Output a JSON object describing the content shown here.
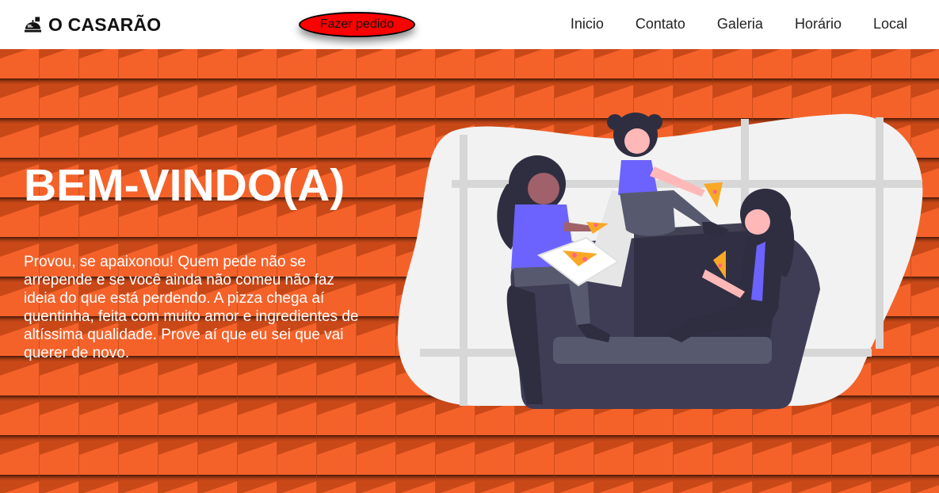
{
  "header": {
    "brand": {
      "icon": "food-tray-icon",
      "name": "O CASARÃO"
    },
    "order_button": "Fazer pedido",
    "nav": [
      {
        "label": "Inicio"
      },
      {
        "label": "Contato"
      },
      {
        "label": "Galeria"
      },
      {
        "label": "Horário"
      },
      {
        "label": "Local"
      }
    ]
  },
  "hero": {
    "title": "BEM-VINDO(A)",
    "text": "Provou, se apaixonou! Quem pede não se arrepende e se você ainda não comeu não faz ideia do que está perdendo. A pizza chega aí quentinha, feita com muito amor e ingredientes de altíssima qualidade. Prove aí que eu sei que vai querer de novo.",
    "illustration": "women-eating-pizza-on-sofa-illustration"
  },
  "colors": {
    "accent": "#f05a22",
    "button": "#ff0000",
    "header_bg": "#ffffff",
    "text_light": "#ffffff",
    "sofa": "#3f3d56",
    "shirt": "#6c63ff"
  }
}
